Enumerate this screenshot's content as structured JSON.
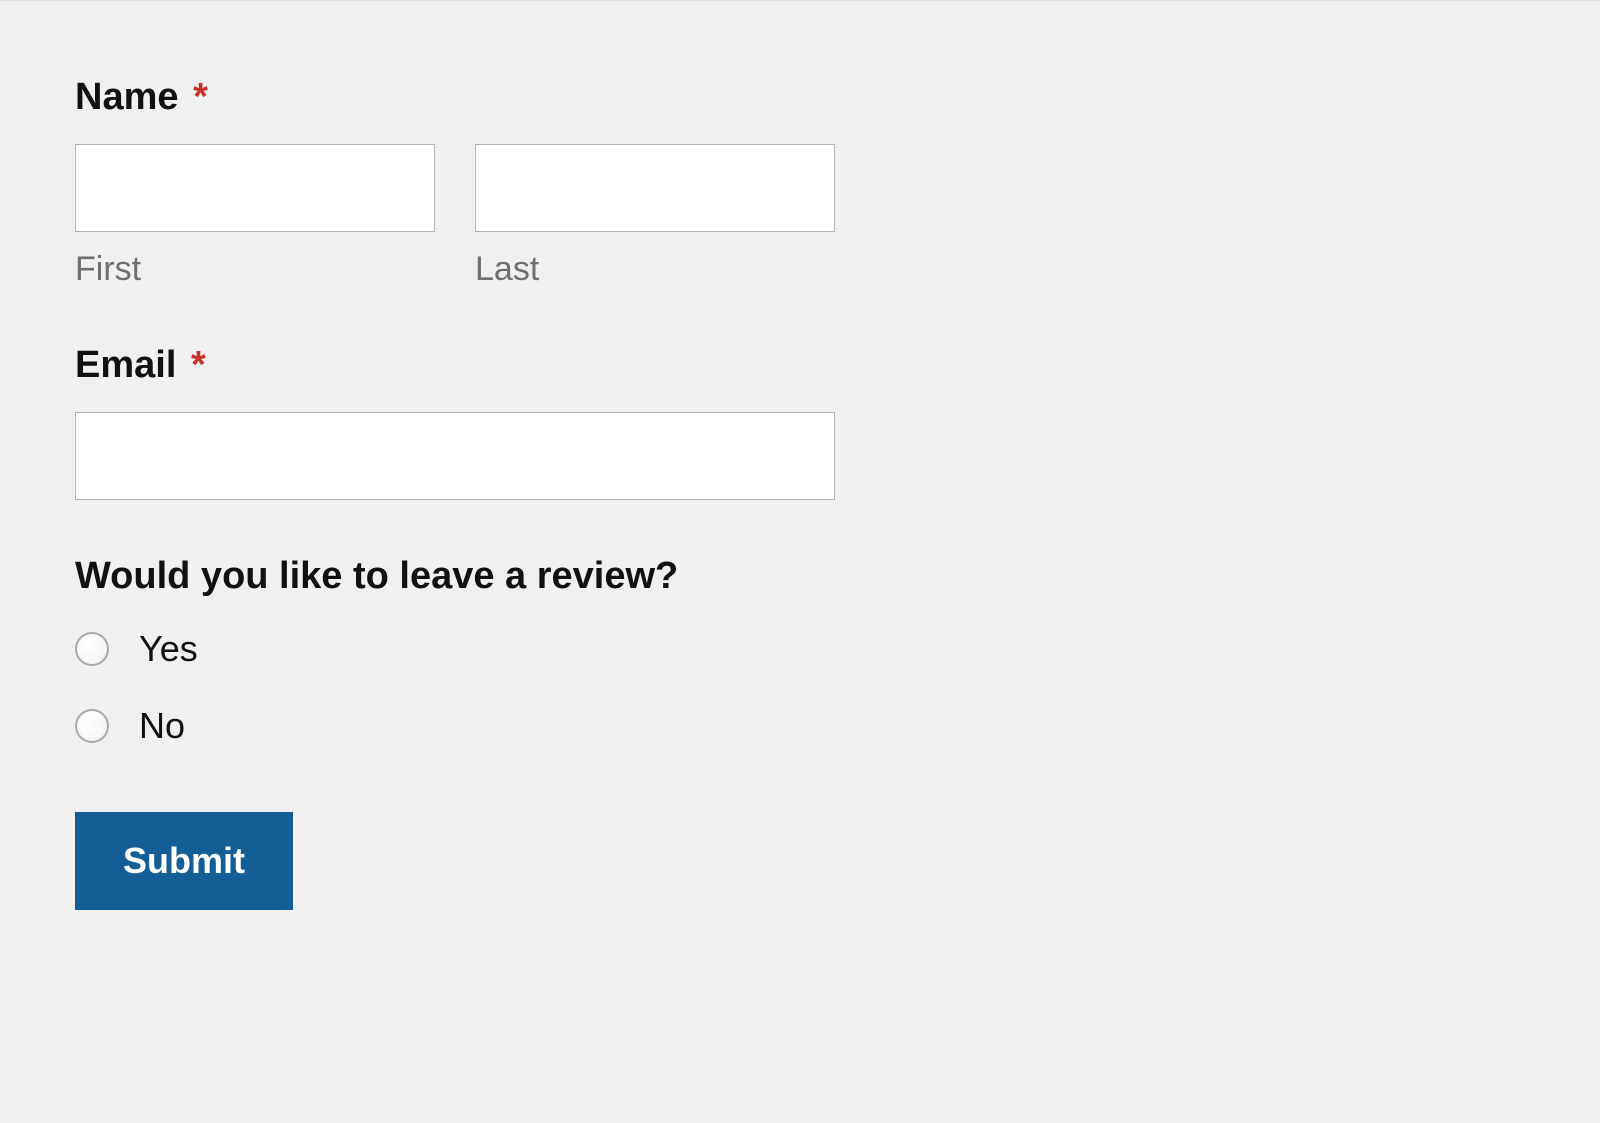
{
  "form": {
    "name": {
      "label": "Name",
      "required_marker": "*",
      "first_sublabel": "First",
      "last_sublabel": "Last",
      "first_value": "",
      "last_value": ""
    },
    "email": {
      "label": "Email",
      "required_marker": "*",
      "value": ""
    },
    "review": {
      "label": "Would you like to leave a review?",
      "options": {
        "yes": "Yes",
        "no": "No"
      }
    },
    "submit_label": "Submit"
  }
}
